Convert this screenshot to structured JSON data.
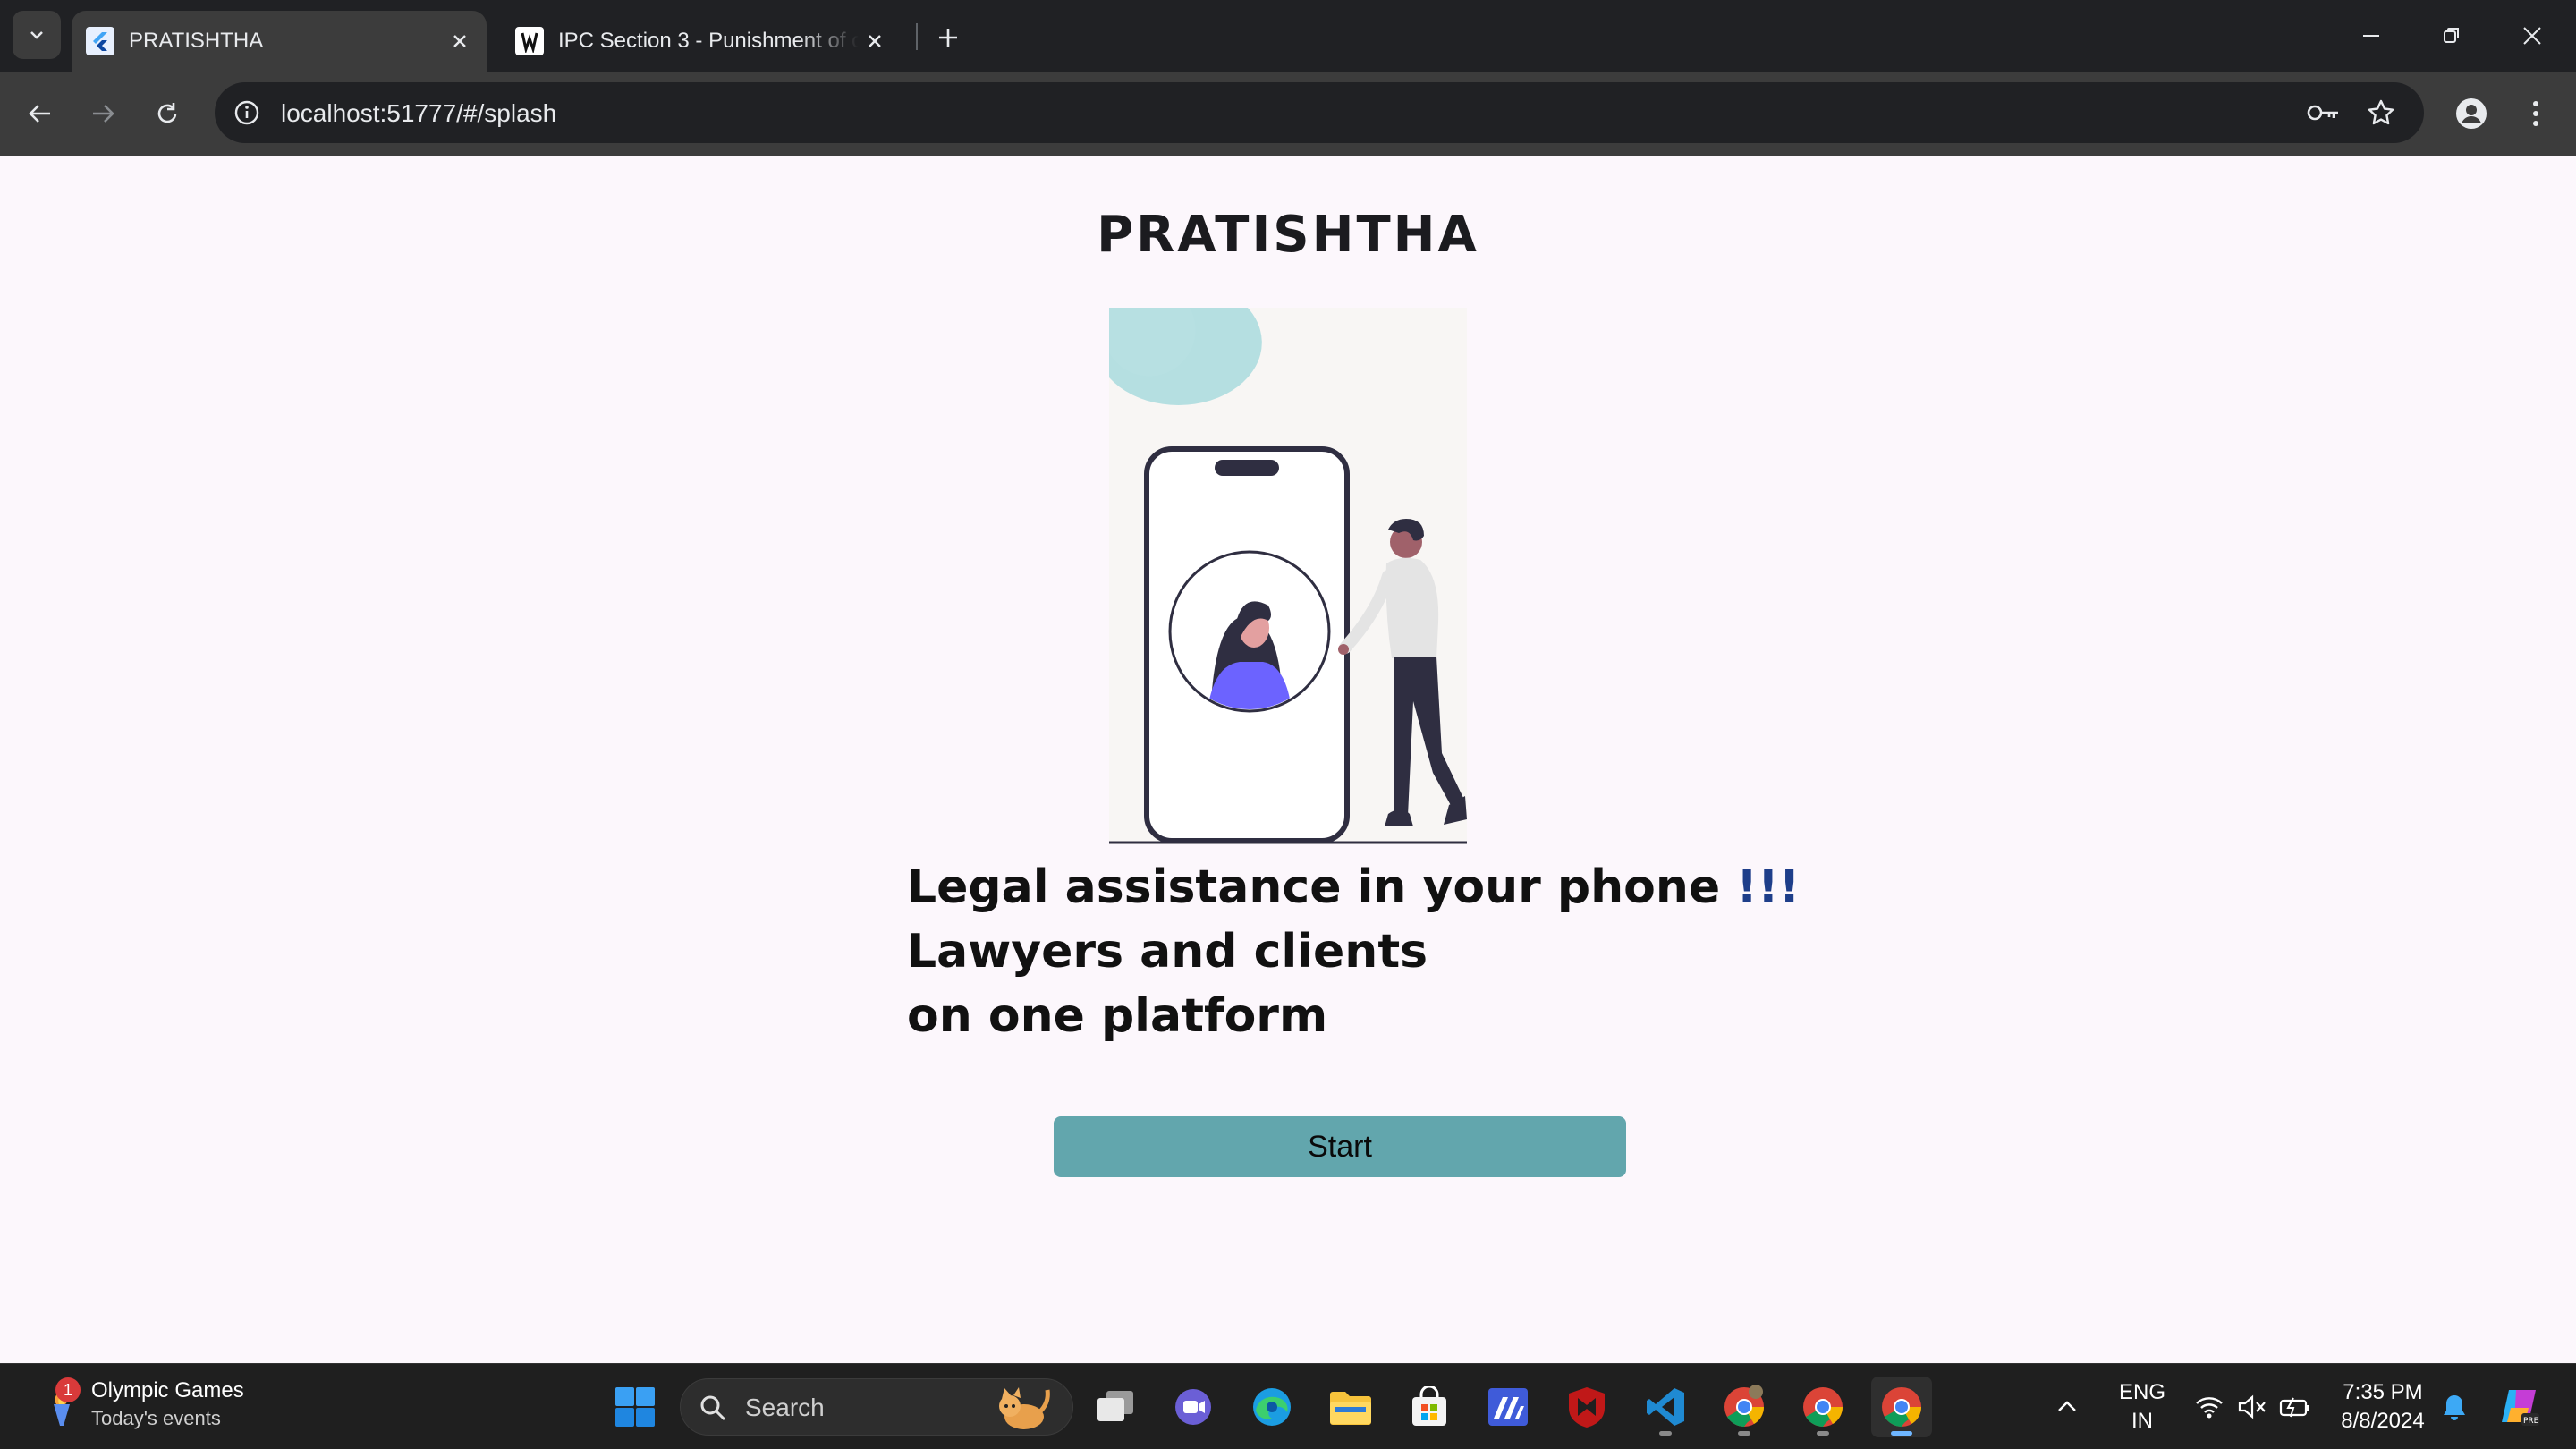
{
  "browser": {
    "tabs": [
      {
        "title": "PRATISHTHA",
        "active": true,
        "favicon": "flutter-icon"
      },
      {
        "title": "IPC Section 3 - Punishment of o",
        "active": false,
        "favicon": "wiki-icon"
      }
    ],
    "address": "localhost:51777/#/splash"
  },
  "page": {
    "app_title": "PRATISHTHA",
    "tagline_line1": "Legal assistance in your phone ",
    "tagline_exclaim": "!!!",
    "tagline_line2": "Lawyers and clients",
    "tagline_line3": "on one platform",
    "start_label": "Start",
    "colors": {
      "accent": "#62a6ad",
      "background": "#fcf7fc",
      "exclaim": "#1e3e8a"
    }
  },
  "taskbar": {
    "widget": {
      "title": "Olympic Games",
      "subtitle": "Today's events",
      "badge": "1"
    },
    "search_label": "Search",
    "language": {
      "line1": "ENG",
      "line2": "IN"
    },
    "time": "7:35 PM",
    "date": "8/8/2024"
  }
}
